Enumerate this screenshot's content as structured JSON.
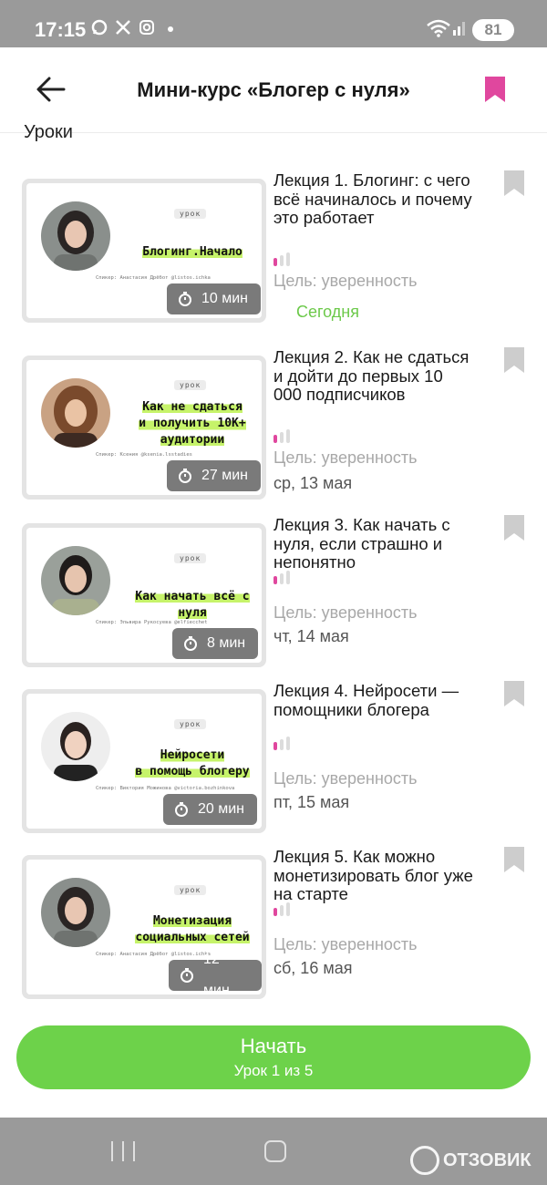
{
  "status_bar": {
    "time": "17:15",
    "battery": "81"
  },
  "header": {
    "title": "Мини-курс «Блогер с нуля»"
  },
  "section": {
    "label": "Уроки"
  },
  "lessons": [
    {
      "title": "Лекция 1. Блогинг: с чего всё начиналось и почему это работает",
      "thumb_tag": "урок",
      "thumb_title": "Блогинг.Начало",
      "speaker": "Спикер: Анастасия Дрёбот @listos.ichka",
      "duration": "10 мин",
      "goal": "Цель: уверенность",
      "date": "Сегодня",
      "level": 1
    },
    {
      "title": "Лекция 2. Как не сдаться и дойти до первых 10 000 подписчиков",
      "thumb_tag": "урок",
      "thumb_title": "Как не сдаться\nи получить 10К+\nаудитории",
      "speaker": "Спикер: Ксения @ksenia.lsstadies",
      "duration": "27 мин",
      "goal": "Цель: уверенность",
      "date": "ср, 13 мая",
      "level": 1
    },
    {
      "title": "Лекция 3. Как начать с нуля, если страшно и непонятно",
      "thumb_tag": "урок",
      "thumb_title": "Как начать всё с нуля",
      "speaker": "Спикер: Эльвира Рукосуева @elfiecchet",
      "duration": "8 мин",
      "goal": "Цель: уверенность",
      "date": "чт, 14 мая",
      "level": 1
    },
    {
      "title": "Лекция 4. Нейросети — помощники блогера",
      "thumb_tag": "урок",
      "thumb_title": "Нейросети\nв помощь блогеру",
      "speaker": "Спикер: Виктория Можинова @victoria.bozhinkova",
      "duration": "20 мин",
      "goal": "Цель: уверенность",
      "date": "пт, 15 мая",
      "level": 1
    },
    {
      "title": "Лекция 5. Как можно монетизировать блог уже на старте",
      "thumb_tag": "урок",
      "thumb_title": "Монетизация\nсоциальных сетей",
      "speaker": "Спикер: Анастасия Дрёбот @listos.ichka",
      "duration": "12 мин",
      "goal": "Цель: уверенность",
      "date": "сб, 16 мая",
      "level": 1
    }
  ],
  "start_button": {
    "label": "Начать",
    "sub": "Урок 1 из 5"
  },
  "watermark": {
    "text": "ОТЗОВИК"
  },
  "colors": {
    "accent_green": "#6dd24a",
    "bookmark_pink": "#e0479e",
    "highlight": "#c6f36a"
  }
}
